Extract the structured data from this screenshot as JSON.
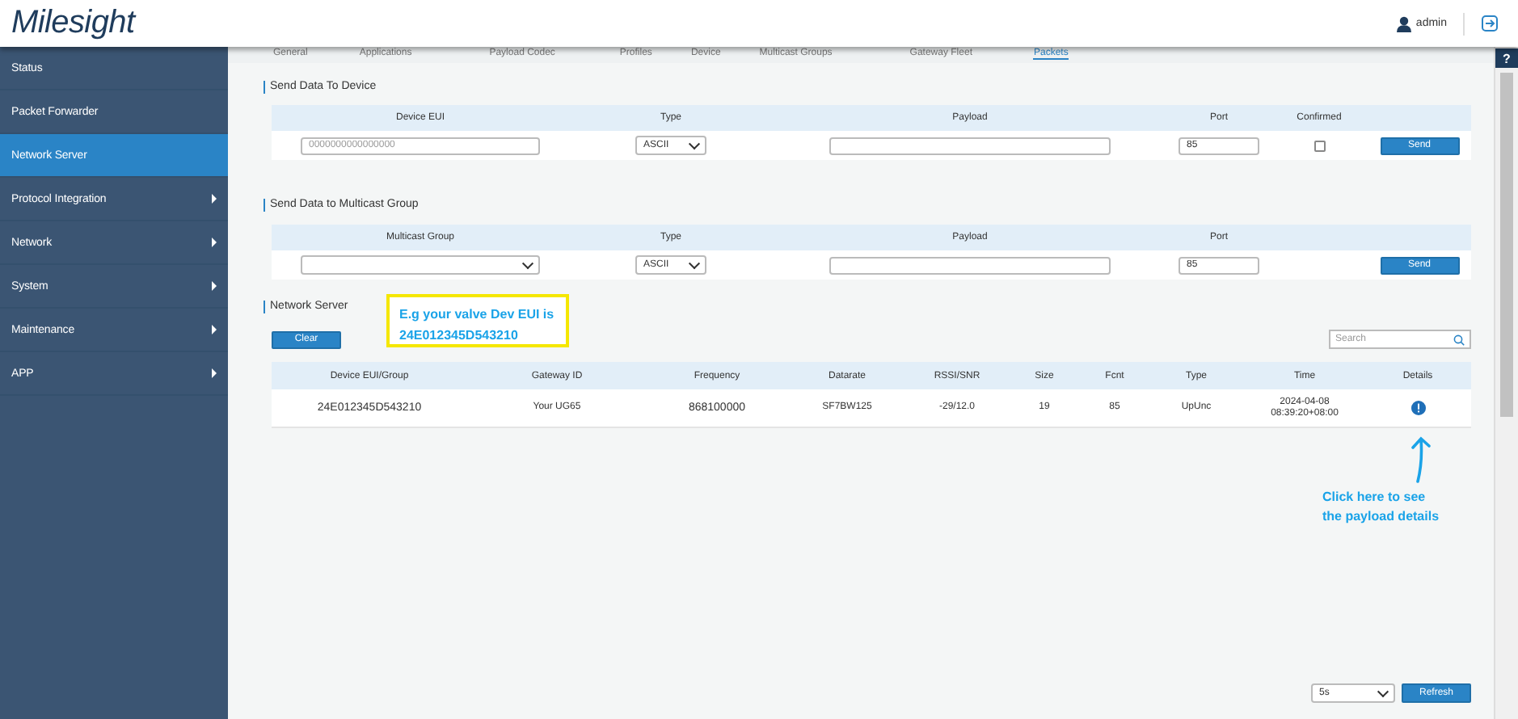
{
  "header": {
    "logo": "Milesight",
    "user": "admin"
  },
  "help_button": "?",
  "sidebar": {
    "items": [
      {
        "label": "Status",
        "selected": false,
        "has_submenu": false
      },
      {
        "label": "Packet Forwarder",
        "selected": false,
        "has_submenu": false
      },
      {
        "label": "Network Server",
        "selected": true,
        "has_submenu": false
      },
      {
        "label": "Protocol Integration",
        "selected": false,
        "has_submenu": true
      },
      {
        "label": "Network",
        "selected": false,
        "has_submenu": true
      },
      {
        "label": "System",
        "selected": false,
        "has_submenu": true
      },
      {
        "label": "Maintenance",
        "selected": false,
        "has_submenu": true
      },
      {
        "label": "APP",
        "selected": false,
        "has_submenu": true
      }
    ]
  },
  "tabs": [
    {
      "label": "General",
      "selected": false
    },
    {
      "label": "Applications",
      "selected": false
    },
    {
      "label": "Payload Codec",
      "selected": false
    },
    {
      "label": "Profiles",
      "selected": false
    },
    {
      "label": "Device",
      "selected": false
    },
    {
      "label": "Multicast Groups",
      "selected": false
    },
    {
      "label": "Gateway Fleet",
      "selected": false
    },
    {
      "label": "Packets",
      "selected": true
    }
  ],
  "send_to_device": {
    "title": "Send Data To Device",
    "columns": [
      "Device EUI",
      "Type",
      "Payload",
      "Port",
      "Confirmed"
    ],
    "device_eui_placeholder": "0000000000000000",
    "type": "ASCII",
    "port": "85",
    "confirmed": false,
    "button": "Send"
  },
  "send_to_multicast": {
    "title": "Send Data to Multicast Group",
    "columns": [
      "Multicast Group",
      "Type",
      "Payload",
      "Port"
    ],
    "type": "ASCII",
    "port": "85",
    "button": "Send"
  },
  "network_server": {
    "title": "Network Server",
    "clear_button": "Clear",
    "search_placeholder": "Search",
    "columns": [
      "Device EUI/Group",
      "Gateway ID",
      "Frequency",
      "Datarate",
      "RSSI/SNR",
      "Size",
      "Fcnt",
      "Type",
      "Time",
      "Details"
    ],
    "rows": [
      {
        "cells": [
          "24E012345D543210",
          "Your UG65",
          "868100000",
          "SF7BW125",
          "-29/12.0",
          "19",
          "85",
          "UpUnc",
          "2024-04-08\n08:39:20+08:00"
        ]
      }
    ]
  },
  "callout": {
    "text": "E.g your valve Dev EUI is\n24E012345D543210"
  },
  "annotation": {
    "text": "Click here to see\nthe payload details"
  },
  "footer": {
    "refresh_interval": "5s",
    "refresh_button": "Refresh"
  }
}
